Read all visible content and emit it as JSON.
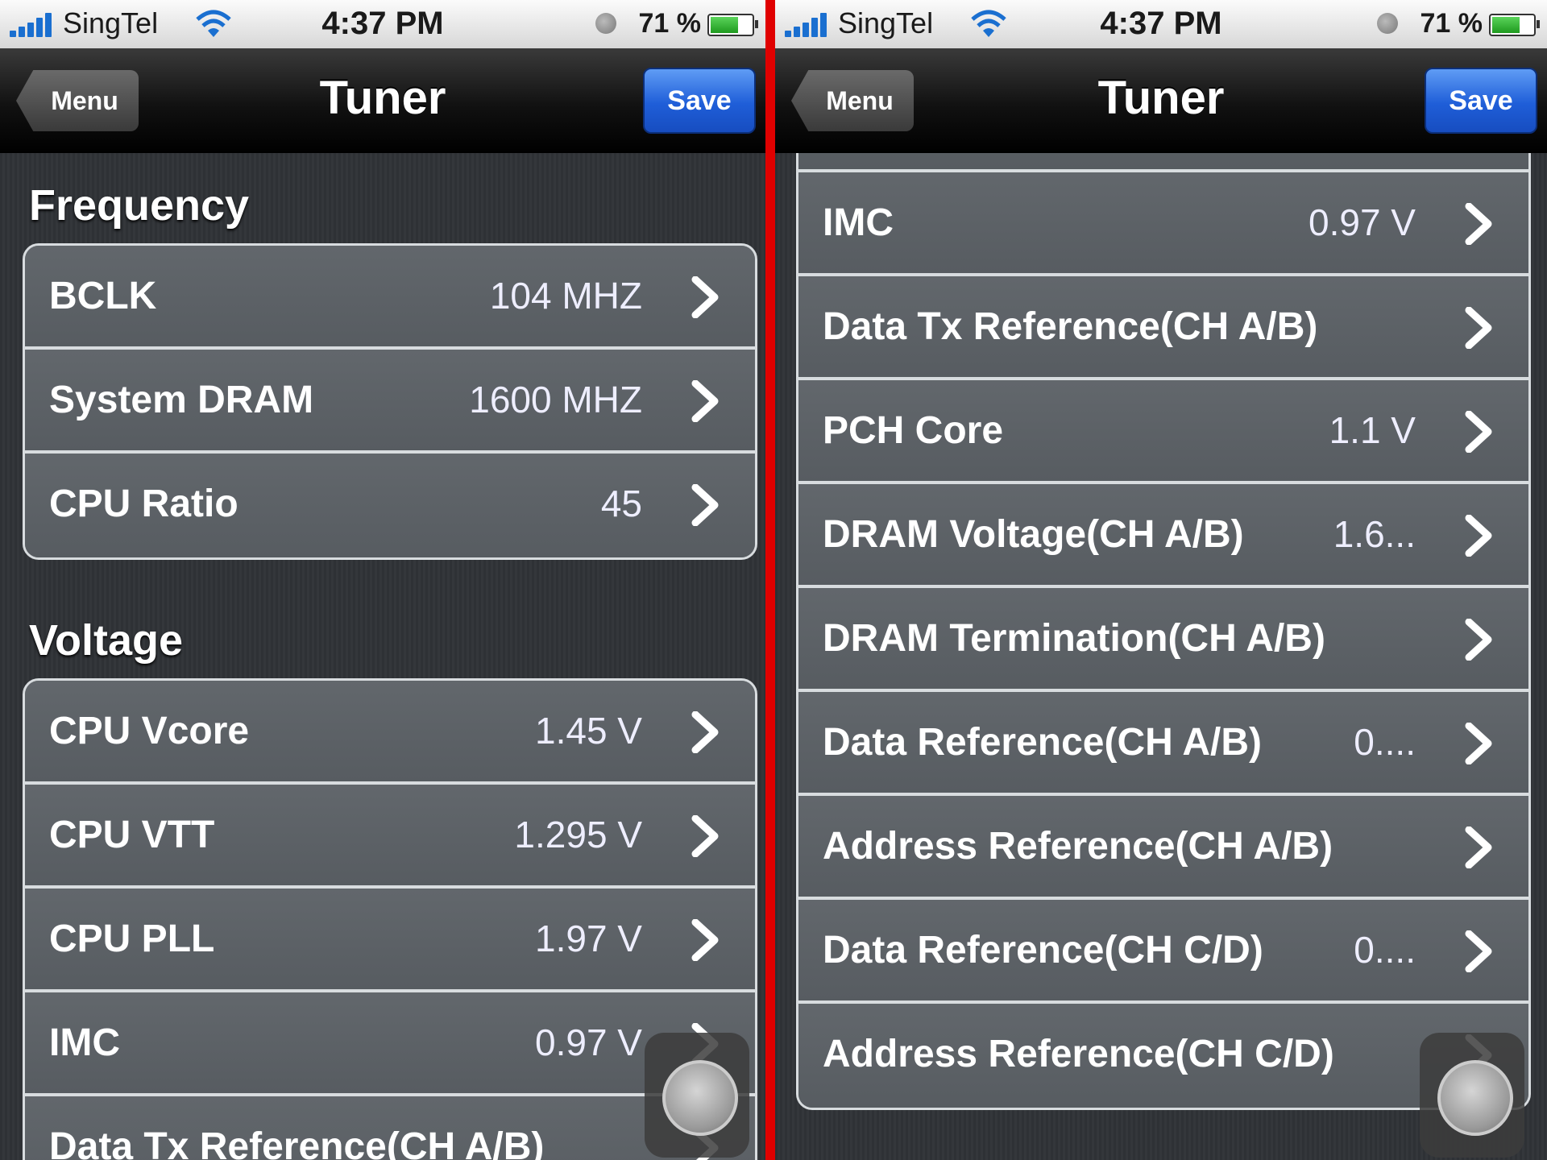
{
  "status_bar": {
    "carrier": "SingTel",
    "time": "4:37 PM",
    "battery_percent_label": "71 %",
    "battery_level": 0.71,
    "icons": [
      "signal-icon",
      "wifi-icon",
      "clock-icon",
      "battery-icon"
    ]
  },
  "navbar": {
    "back_label": "Menu",
    "title": "Tuner",
    "save_label": "Save"
  },
  "left_screen": {
    "sections": [
      {
        "header": "Frequency",
        "rows": [
          {
            "label": "BCLK",
            "value": "104 MHZ"
          },
          {
            "label": "System DRAM",
            "value": "1600 MHZ"
          },
          {
            "label": "CPU Ratio",
            "value": "45"
          }
        ]
      },
      {
        "header": "Voltage",
        "rows": [
          {
            "label": "CPU Vcore",
            "value": "1.45 V"
          },
          {
            "label": "CPU VTT",
            "value": "1.295 V"
          },
          {
            "label": "CPU PLL",
            "value": "1.97 V"
          },
          {
            "label": "IMC",
            "value": "0.97 V"
          },
          {
            "label": "Data Tx Reference(CH A/B)",
            "value": ""
          }
        ]
      }
    ]
  },
  "right_screen": {
    "rows": [
      {
        "label": "",
        "value": ""
      },
      {
        "label": "IMC",
        "value": "0.97 V"
      },
      {
        "label": "Data Tx Reference(CH A/B)",
        "value": ""
      },
      {
        "label": "PCH Core",
        "value": "1.1 V"
      },
      {
        "label": "DRAM Voltage(CH A/B)",
        "value": "1.6..."
      },
      {
        "label": "DRAM Termination(CH A/B)",
        "value": ""
      },
      {
        "label": "Data Reference(CH A/B)",
        "value": "0...."
      },
      {
        "label": "Address Reference(CH A/B)",
        "value": ""
      },
      {
        "label": "Data Reference(CH C/D)",
        "value": "0...."
      },
      {
        "label": "Address Reference(CH C/D)",
        "value": ""
      }
    ]
  },
  "colors": {
    "accent_save": "#1f5ed8",
    "divider": "#e00000",
    "row_bg": "#5b6065"
  }
}
